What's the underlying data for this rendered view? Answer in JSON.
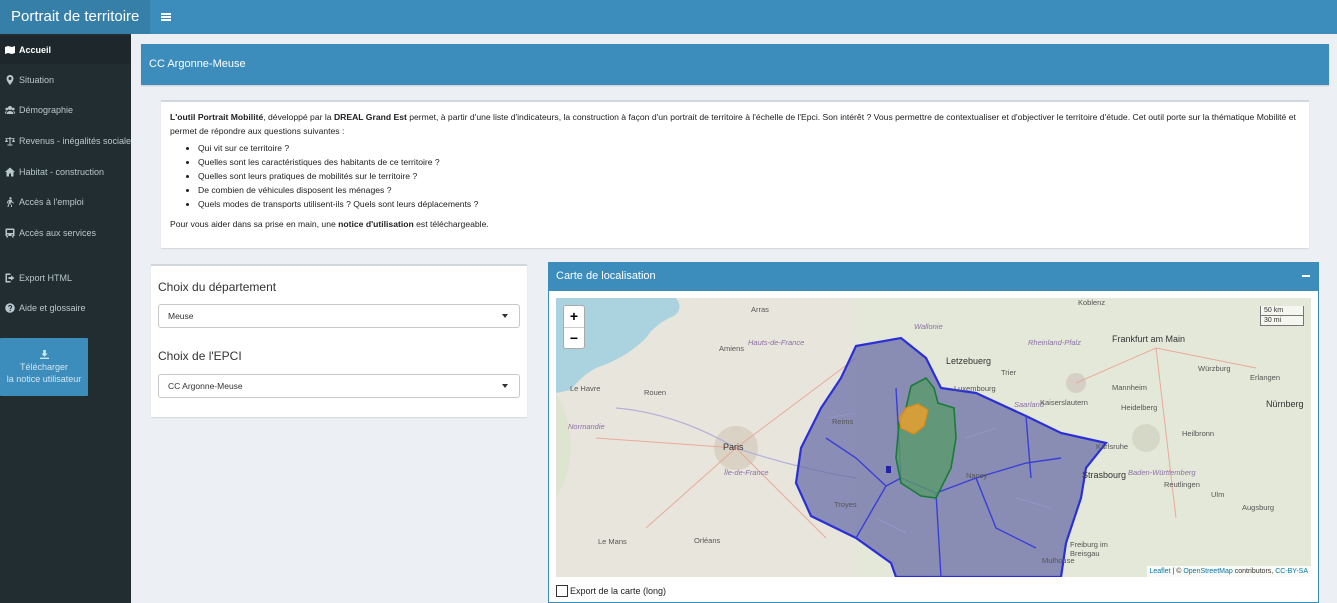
{
  "app": {
    "title": "Portrait de territoire"
  },
  "sidebar": {
    "items": [
      {
        "label": "Accueil",
        "icon": "map-icon",
        "active": true
      },
      {
        "label": "Situation",
        "icon": "map-marker-icon"
      },
      {
        "label": "Démographie",
        "icon": "users-icon"
      },
      {
        "label": "Revenus - inégalités sociales",
        "icon": "balance-scale-icon"
      },
      {
        "label": "Habitat - construction",
        "icon": "home-icon"
      },
      {
        "label": "Accès à l'emploi",
        "icon": "walking-icon"
      },
      {
        "label": "Accès aux services",
        "icon": "bus-icon"
      },
      {
        "label": "Export HTML",
        "icon": "sign-out-icon"
      },
      {
        "label": "Aide et glossaire",
        "icon": "question-circle-icon"
      }
    ],
    "download": {
      "line1": "Télécharger",
      "line2": "la notice utilisateur"
    }
  },
  "page": {
    "title": "CC Argonne-Meuse"
  },
  "intro": {
    "p1_b1": "L'outil Portrait Mobilité",
    "p1_t1": ", développé par la ",
    "p1_b2": "DREAL Grand Est",
    "p1_t2": " permet, à partir d'une liste d'indicateurs, la construction à façon d'un portrait de territoire à l'échelle de l'Epci. Son intérêt ? Vous permettre de contextualiser et d'objectiver le territoire d'étude. Cet outil porte sur la thématique Mobilité et permet de répondre aux questions suivantes :",
    "questions": [
      "Qui vit sur ce territoire ?",
      "Quelles sont les caractéristiques des habitants de ce territoire ?",
      "Quelles sont leurs pratiques de mobilités sur le territoire ?",
      "De combien de véhicules disposent les ménages ?",
      "Quels modes de transports utilisent-ils ? Quels sont leurs déplacements ?"
    ],
    "p2_t1": "Pour vous aider dans sa prise en main, une ",
    "p2_b1": "notice d'utilisation",
    "p2_t2": " est téléchargeable."
  },
  "selection": {
    "dept_label": "Choix du département",
    "dept_value": "Meuse",
    "epci_label": "Choix de l'EPCI",
    "epci_value": "CC Argonne-Meuse"
  },
  "map": {
    "title": "Carte de localisation",
    "zoom_in": "+",
    "zoom_out": "−",
    "scale_km": "50 km",
    "scale_mi": "30 mi",
    "attribution": {
      "leaflet": "Leaflet",
      "sep": " | © ",
      "osm": "OpenStreetMap",
      "contrib": " contributors, ",
      "license": "CC-BY-SA"
    },
    "labels": [
      "Koblenz",
      "Wallonie",
      "Arras",
      "Letzebuerg",
      "Rheinland-Pfalz",
      "Frankfurt am Main",
      "Amiens",
      "Hauts-de-France",
      "Luxembourg",
      "Trier",
      "Mannheim",
      "Würzburg",
      "Le Havre",
      "Rouen",
      "Saarland",
      "Kaiserslautern",
      "Heidelberg",
      "Erlangen",
      "Nürnberg",
      "Normandie",
      "Reims",
      "Heilbronn",
      "Paris",
      "Île-de-France",
      "Karlsruhe",
      "Strasbourg",
      "Baden-Württemberg",
      "Reutlingen",
      "Troyes",
      "Ulm",
      "Augsburg",
      "Le Mans",
      "Orléans",
      "Freiburg im Breisgau",
      "Mulhouse",
      "Nancy"
    ],
    "export_label": "Export de la carte (long)",
    "colors": {
      "region_fill": "#6b6fa8",
      "region_border": "#2b2fd6",
      "epci_fill": "#5a9a6a",
      "epci_border": "#1a7a3a",
      "highlight": "#e8a030"
    }
  }
}
